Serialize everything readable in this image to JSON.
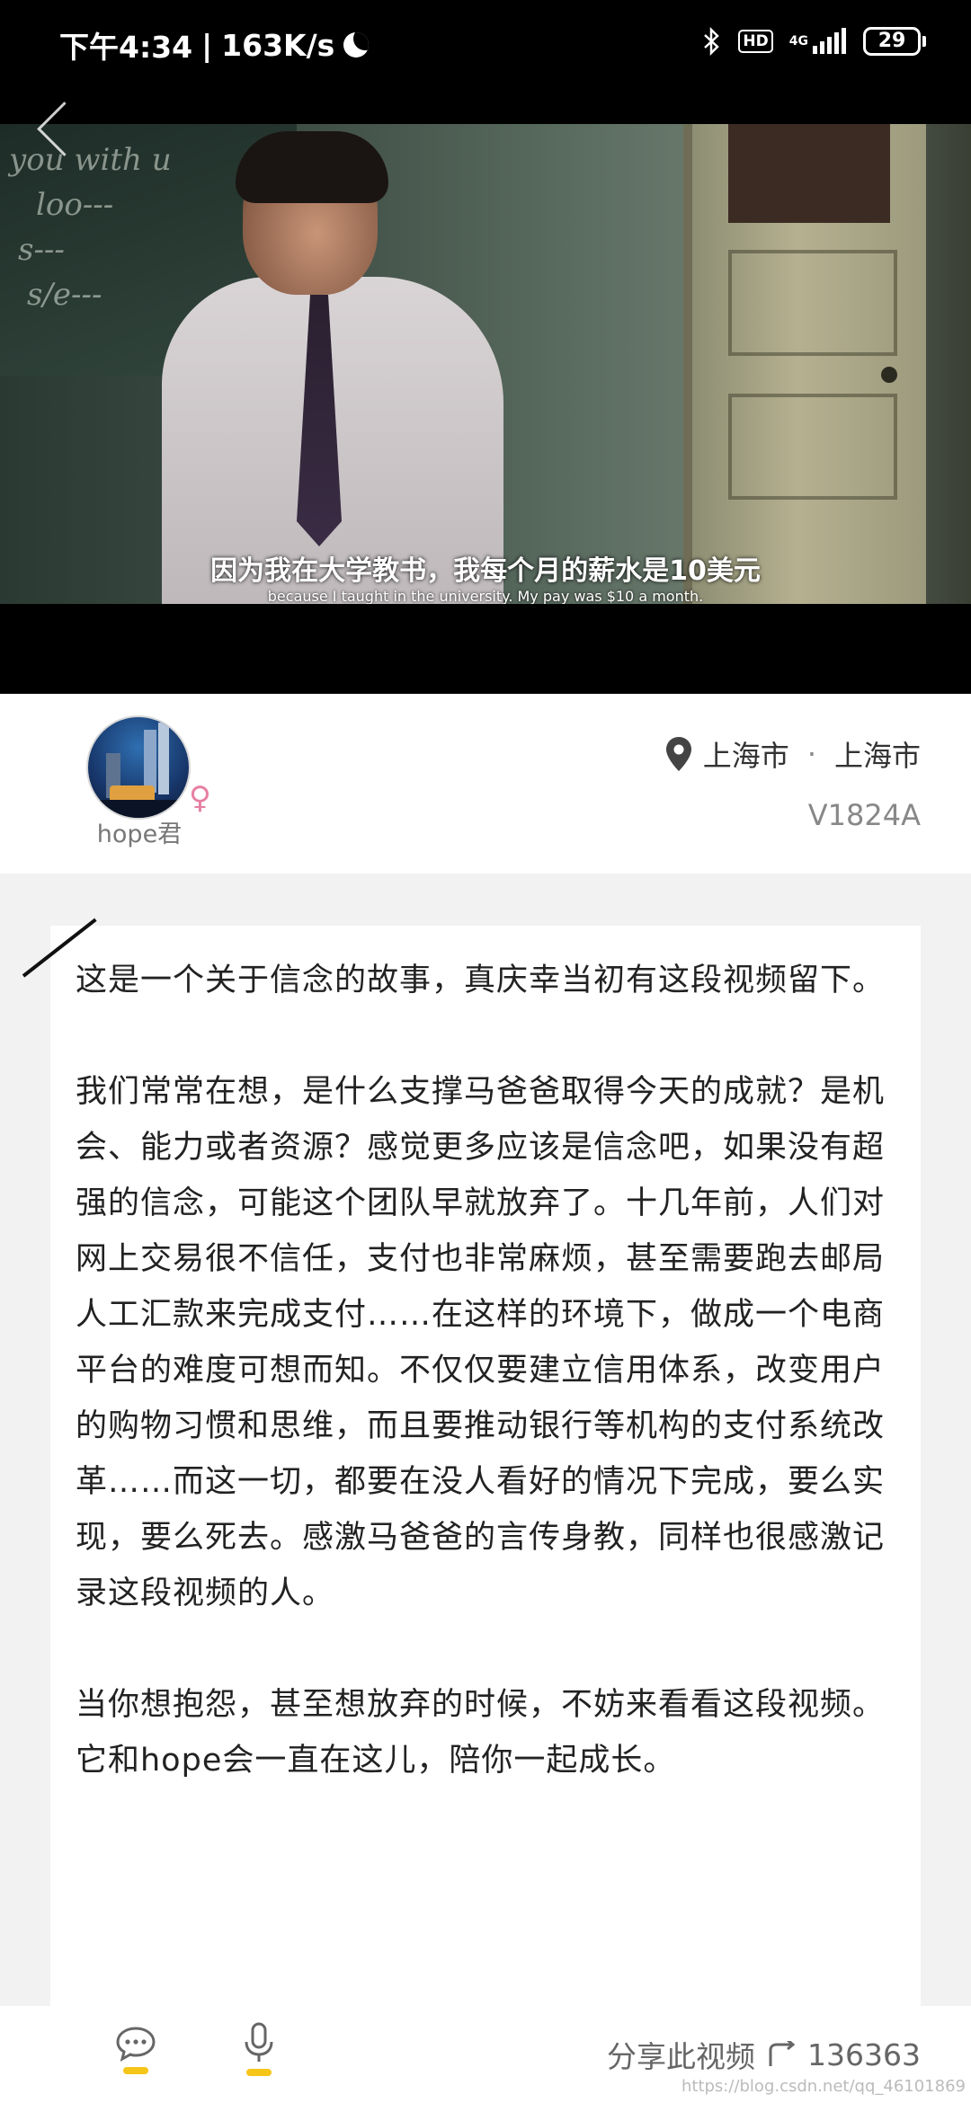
{
  "status_bar": {
    "time": "下午4:34",
    "separator": "|",
    "speed": "163K/s",
    "hd": "HD",
    "network": "4G",
    "battery": "29"
  },
  "video": {
    "subtitle_zh": "因为我在大学教书，我每个月的薪水是10美元",
    "subtitle_en": "because I taught in the university. My pay was $10 a month.",
    "chalk_lines": [
      "you with u",
      "loo---",
      "s---",
      "s/e---"
    ]
  },
  "author": {
    "username": "hope君",
    "gender_symbol": "♀",
    "province": "上海市",
    "dot": "·",
    "city": "上海市",
    "video_code": "V1824A"
  },
  "post": {
    "paragraphs": [
      "这是一个关于信念的故事，真庆幸当初有这段视频留下。",
      "",
      "我们常常在想，是什么支撑马爸爸取得今天的成就？是机会、能力或者资源？感觉更多应该是信念吧，如果没有超强的信念，可能这个团队早就放弃了。十几年前，人们对网上交易很不信任，支付也非常麻烦，甚至需要跑去邮局人工汇款来完成支付……在这样的环境下，做成一个电商平台的难度可想而知。不仅仅要建立信用体系，改变用户的购物习惯和思维，而且要推动银行等机构的支付系统改革……而这一切，都要在没人看好的情况下完成，要么实现，要么死去。感激马爸爸的言传身教，同样也很感激记录这段视频的人。",
      "",
      "当你想抱怨，甚至想放弃的时候，不妨来看看这段视频。",
      "它和hope会一直在这儿，陪你一起成长。"
    ]
  },
  "bottom_bar": {
    "share_label": "分享此视频",
    "share_count": "136363",
    "watermark": "https://blog.csdn.net/qq_46101869"
  },
  "icons": {
    "back": "chevron-left-icon",
    "location": "location-pin-icon",
    "comment": "chat-bubble-icon",
    "mic": "microphone-icon",
    "share": "share-icon"
  },
  "colors": {
    "accent_yellow": "#f5c518",
    "gender_pink": "#e87fa3"
  }
}
